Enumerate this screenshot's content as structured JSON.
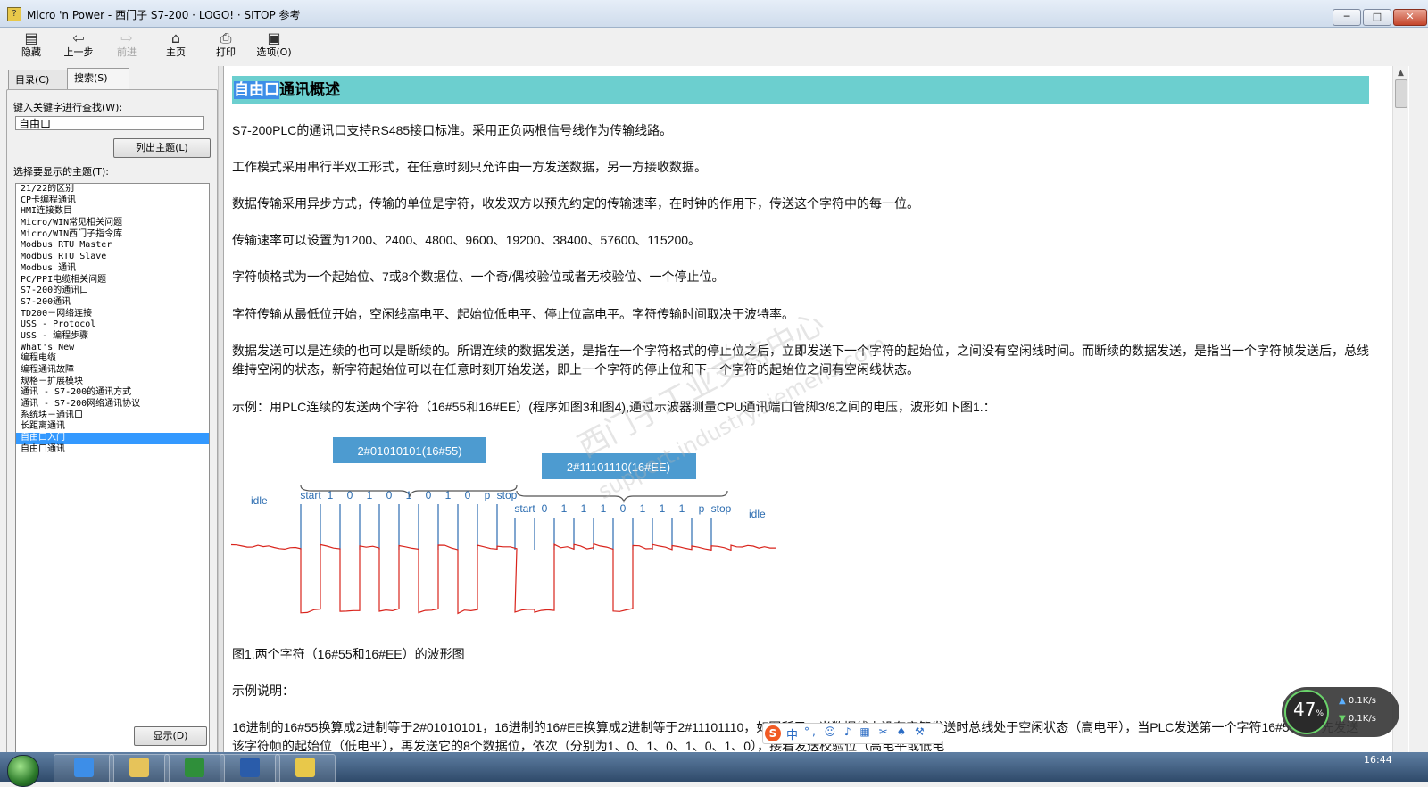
{
  "window": {
    "title": "Micro 'n Power - 西门子 S7-200 · LOGO! · SITOP 参考",
    "minimize_glyph": "─",
    "maximize_glyph": "□",
    "close_glyph": "✕"
  },
  "toolbar": {
    "hide": "隐藏",
    "back": "上一步",
    "forward": "前进",
    "home": "主页",
    "print": "打印",
    "options": "选项(O)"
  },
  "left_pane": {
    "tab_contents": "目录(C)",
    "tab_search": "搜索(S)",
    "keyword_label": "键入关键字进行查找(W):",
    "keyword_value": "自由口",
    "list_topics_button": "列出主题(L)",
    "select_topic_label": "选择要显示的主题(T):",
    "topics": [
      "21/22的区别",
      "CP卡编程通讯",
      "HMI连接数目",
      "Micro/WIN常见相关问题",
      "Micro/WIN西门子指令库",
      "Modbus RTU Master",
      "Modbus RTU Slave",
      "Modbus 通讯",
      "PC/PPI电缆相关问题",
      "S7-200的通讯口",
      "S7-200通讯",
      "TD200－网络连接",
      "USS - Protocol",
      "USS - 编程步骤",
      "What's New",
      "编程电缆",
      "编程通讯故障",
      "规格－扩展模块",
      "通讯 - S7-200的通讯方式",
      "通讯 - S7-200网络通讯协议",
      "系统块－通讯口",
      "长距离通讯",
      "自由口入门",
      "自由口通讯"
    ],
    "selected_index": 22,
    "show_button": "显示(D)"
  },
  "content": {
    "heading_highlight": "自由口",
    "heading_rest": "通讯概述",
    "paragraphs": [
      "S7-200PLC的通讯口支持RS485接口标准。采用正负两根信号线作为传输线路。",
      "工作模式采用串行半双工形式，在任意时刻只允许由一方发送数据，另一方接收数据。",
      "数据传输采用异步方式，传输的单位是字符，收发双方以预先约定的传输速率，在时钟的作用下，传送这个字符中的每一位。",
      "传输速率可以设置为1200、2400、4800、9600、19200、38400、57600、115200。",
      "字符帧格式为一个起始位、7或8个数据位、一个奇/偶校验位或者无校验位、一个停止位。",
      "字符传输从最低位开始，空闲线高电平、起始位低电平、停止位高电平。字符传输时间取决于波特率。",
      "数据发送可以是连续的也可以是断续的。所谓连续的数据发送，是指在一个字符格式的停止位之后，立即发送下一个字符的起始位，之间没有空闲线时间。而断续的数据发送，是指当一个字符帧发送后，总线维持空闲的状态，新字符起始位可以在任意时刻开始发送，即上一个字符的停止位和下一个字符的起始位之间有空闲线状态。",
      "示例：用PLC连续的发送两个字符（16#55和16#EE）(程序如图3和图4),通过示波器测量CPU通讯端口管脚3/8之间的电压，波形如下图1.："
    ],
    "figure_caption": "图1.两个字符（16#55和16#EE）的波形图",
    "example_label": "示例说明：",
    "last_paragraph": "16进制的16#55换算成2进制等于2#01010101，16进制的16#EE换算成2进制等于2#11101110，如图所示，当数据线上没有字符发送时总线处于空闲状态（高电平），当PLC发送第一个字符16#55时，先发送该字符帧的起始位（低电平），再发送它的8个数据位，依次（分别为1、0、1、0、1、0、1、0），接着发送校验位（高电平或低电"
  },
  "waveform": {
    "box1_label": "2#01010101(16#55)",
    "box2_label": "2#11101110(16#EE)",
    "idle_left": "idle",
    "idle_right": "idle",
    "char1_bits": [
      "start",
      "1",
      "0",
      "1",
      "0",
      "1",
      "0",
      "1",
      "0",
      "p",
      "stop"
    ],
    "char2_bits": [
      "start",
      "0",
      "1",
      "1",
      "1",
      "0",
      "1",
      "1",
      "1",
      "p",
      "stop"
    ],
    "accent_box": "#4d9bd0",
    "signal_color": "#d9241c",
    "marker_color": "#2b6cb0"
  },
  "watermark": {
    "line1": "西门子工业支持中心",
    "line2": "support.industry.siemens.com"
  },
  "ime": {
    "logo": "S",
    "lang": "中",
    "tools": "°, ☺ ♪ ▦ ✂ ♠ ⚒"
  },
  "speed_widget": {
    "percent": "47",
    "percent_unit": "%",
    "up_rate": "0.1K/s",
    "down_rate": "0.1K/s"
  },
  "taskbar": {
    "clock": "16:44"
  }
}
